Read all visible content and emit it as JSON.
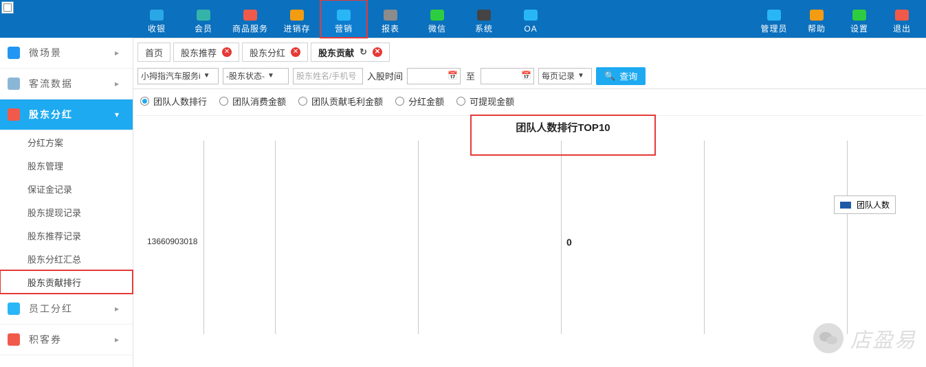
{
  "topnav": {
    "items": [
      {
        "label": "收银",
        "icon": "cashier-icon",
        "color": "#2aa7e6"
      },
      {
        "label": "会员",
        "icon": "member-icon",
        "color": "#34b4a8"
      },
      {
        "label": "商品服务",
        "icon": "goods-icon",
        "color": "#f15a4a"
      },
      {
        "label": "进销存",
        "icon": "inventory-icon",
        "color": "#f39c12"
      },
      {
        "label": "营销",
        "icon": "marketing-icon",
        "color": "#29b6f6",
        "marked": true
      },
      {
        "label": "报表",
        "icon": "report-icon",
        "color": "#8c8c8c"
      },
      {
        "label": "微信",
        "icon": "wechat-icon",
        "color": "#2ecc40"
      },
      {
        "label": "系统",
        "icon": "system-icon",
        "color": "#444"
      },
      {
        "label": "OA",
        "icon": "oa-icon",
        "color": "#29b6f6"
      }
    ],
    "right": [
      {
        "label": "管理员",
        "icon": "admin-icon",
        "color": "#29b6f6"
      },
      {
        "label": "帮助",
        "icon": "help-icon",
        "color": "#f39c12"
      },
      {
        "label": "设置",
        "icon": "settings-icon",
        "color": "#2ecc40"
      },
      {
        "label": "退出",
        "icon": "logout-icon",
        "color": "#f15a4a"
      }
    ]
  },
  "sidebar": {
    "cats": [
      {
        "label": "微场景",
        "icon": "phone-icon",
        "color": "#2196f3"
      },
      {
        "label": "客流数据",
        "icon": "globe-icon",
        "color": "#8bb7d7"
      },
      {
        "label": "股东分红",
        "icon": "doc-icon",
        "color": "#f15a4a",
        "active": true,
        "subs": [
          {
            "label": "分红方案"
          },
          {
            "label": "股东管理"
          },
          {
            "label": "保证金记录"
          },
          {
            "label": "股东提现记录"
          },
          {
            "label": "股东推荐记录"
          },
          {
            "label": "股东分红汇总"
          },
          {
            "label": "股东贡献排行",
            "selected": true
          }
        ]
      },
      {
        "label": "员工分红",
        "icon": "person-icon",
        "color": "#29b6f6"
      },
      {
        "label": "积客券",
        "icon": "ticket-icon",
        "color": "#f15a4a"
      }
    ]
  },
  "tabs": [
    {
      "label": "首页"
    },
    {
      "label": "股东推荐",
      "close": true
    },
    {
      "label": "股东分红",
      "close": true
    },
    {
      "label": "股东贡献",
      "close": true,
      "refresh": true,
      "active": true
    }
  ],
  "filter": {
    "shop": "小拇指汽车服务i",
    "status": "-股东状态-",
    "name_ph": "股东姓名/手机号",
    "date_label": "入股时间",
    "to": "至",
    "page": "每页记录",
    "query": "查询"
  },
  "radios": [
    "团队人数排行",
    "团队消费金额",
    "团队贡献毛利金额",
    "分红金额",
    "可提现金额"
  ],
  "radio_selected": 0,
  "chart_data": {
    "type": "bar",
    "title": "团队人数排行TOP10",
    "categories": [
      "13660903018"
    ],
    "values": [
      0
    ],
    "series_name": "团队人数",
    "legend_pos": "right",
    "orientation": "horizontal"
  },
  "watermark": "店盈易"
}
